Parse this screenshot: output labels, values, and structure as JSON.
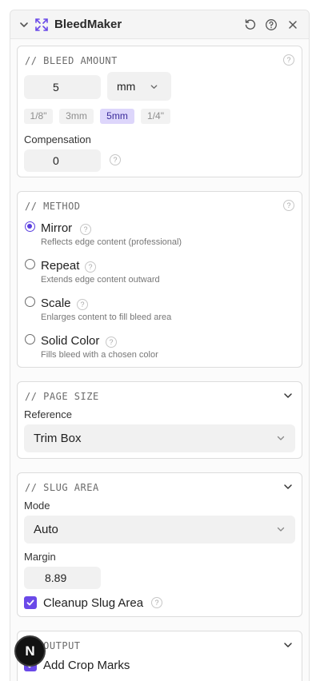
{
  "header": {
    "title": "BleedMaker"
  },
  "bleed_amount": {
    "title": "// BLEED AMOUNT",
    "value": "5",
    "unit": "mm",
    "presets": [
      {
        "label": "1/8\"",
        "active": false
      },
      {
        "label": "3mm",
        "active": false
      },
      {
        "label": "5mm",
        "active": true
      },
      {
        "label": "1/4\"",
        "active": false
      }
    ],
    "compensation_label": "Compensation",
    "compensation_value": "0"
  },
  "method": {
    "title": "// METHOD",
    "options": [
      {
        "label": "Mirror",
        "desc": "Reflects edge content (professional)",
        "selected": true
      },
      {
        "label": "Repeat",
        "desc": "Extends edge content outward",
        "selected": false
      },
      {
        "label": "Scale",
        "desc": "Enlarges content to fill bleed area",
        "selected": false
      },
      {
        "label": "Solid Color",
        "desc": "Fills bleed with a chosen color",
        "selected": false
      }
    ]
  },
  "page_size": {
    "title": "// PAGE SIZE",
    "reference_label": "Reference",
    "reference_value": "Trim Box"
  },
  "slug_area": {
    "title": "// SLUG AREA",
    "mode_label": "Mode",
    "mode_value": "Auto",
    "margin_label": "Margin",
    "margin_value": "8.89",
    "cleanup_label": "Cleanup Slug Area",
    "cleanup_checked": true
  },
  "output": {
    "title": "// OUTPUT",
    "crop_marks_label": "Add Crop Marks",
    "crop_marks_checked": true
  },
  "fab": {
    "letter": "N"
  },
  "colors": {
    "accent": "#6a49e8",
    "active_chip_bg": "#ddd6fb",
    "fab_bg": "#121212"
  }
}
